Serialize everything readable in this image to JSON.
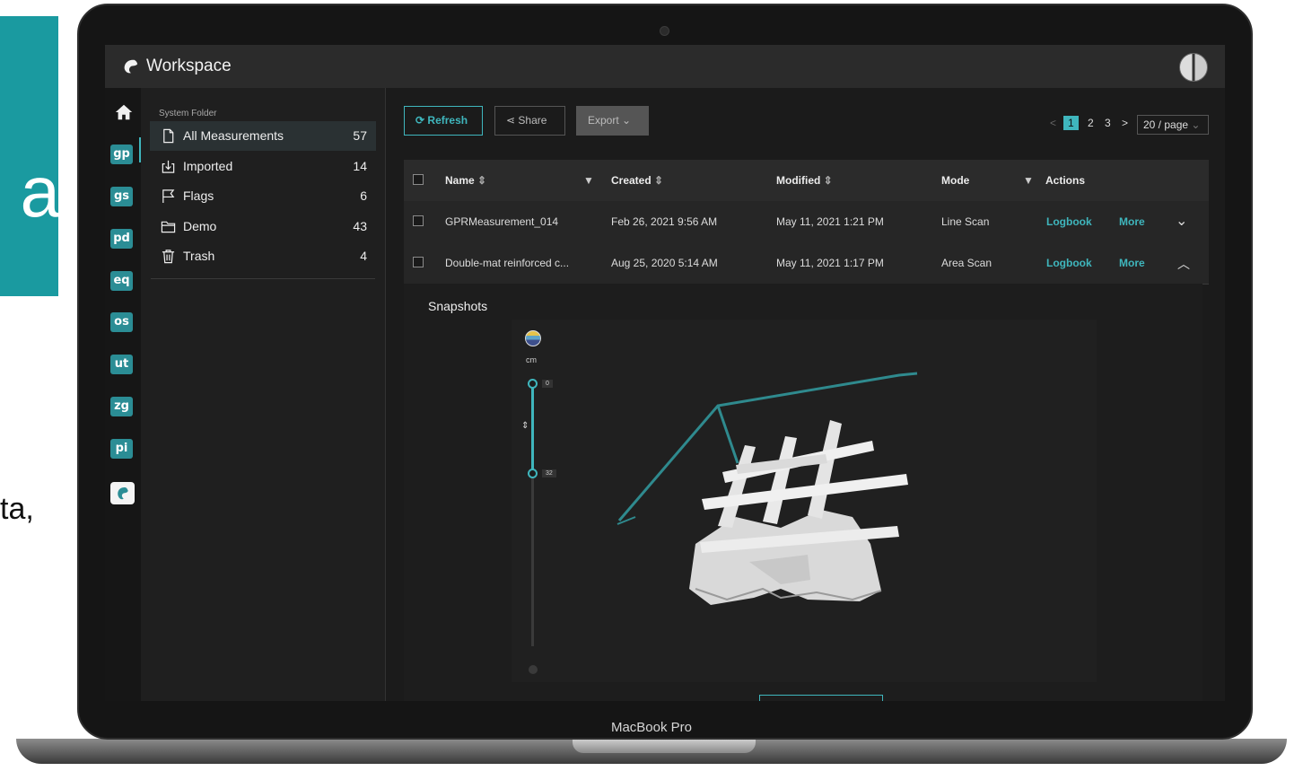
{
  "background": {
    "big_letter": "a",
    "text_fragment": "ta,"
  },
  "device": {
    "label": "MacBook Pro"
  },
  "app": {
    "title": "Workspace",
    "accent": "#3fb6bd",
    "rail_color": "#2b8d95"
  },
  "rail": {
    "items": [
      "gp",
      "gs",
      "pd",
      "eq",
      "os",
      "ut",
      "zg",
      "pi"
    ],
    "active": "gp"
  },
  "folders": {
    "header": "System Folder",
    "items": [
      {
        "label": "All Measurements",
        "count": "57",
        "icon": "document-icon"
      },
      {
        "label": "Imported",
        "count": "14",
        "icon": "import-icon"
      },
      {
        "label": "Flags",
        "count": "6",
        "icon": "flag-icon"
      },
      {
        "label": "Demo",
        "count": "43",
        "icon": "folder-icon"
      },
      {
        "label": "Trash",
        "count": "4",
        "icon": "trash-icon"
      }
    ]
  },
  "toolbar": {
    "refresh": "Refresh",
    "share": "Share",
    "export": "Export"
  },
  "pagination": {
    "pages": [
      "1",
      "2",
      "3"
    ],
    "current": "1",
    "page_size": "20 / page"
  },
  "table": {
    "headers": {
      "name": "Name",
      "created": "Created",
      "modified": "Modified",
      "mode": "Mode",
      "actions": "Actions"
    },
    "rows": [
      {
        "name": "GPRMeasurement_014",
        "created": "Feb 26, 2021 9:56 AM",
        "modified": "May 11, 2021 1:21 PM",
        "mode": "Line Scan",
        "logbook": "Logbook",
        "more": "More",
        "expanded": false
      },
      {
        "name": "Double-mat reinforced c...",
        "created": "Aug 25, 2020 5:14 AM",
        "modified": "May 11, 2021 1:17 PM",
        "mode": "Area Scan",
        "logbook": "Logbook",
        "more": "More",
        "expanded": true
      }
    ]
  },
  "snapshots": {
    "title": "Snapshots",
    "unit": "cm",
    "slider_top": "0",
    "slider_bottom": "32"
  }
}
